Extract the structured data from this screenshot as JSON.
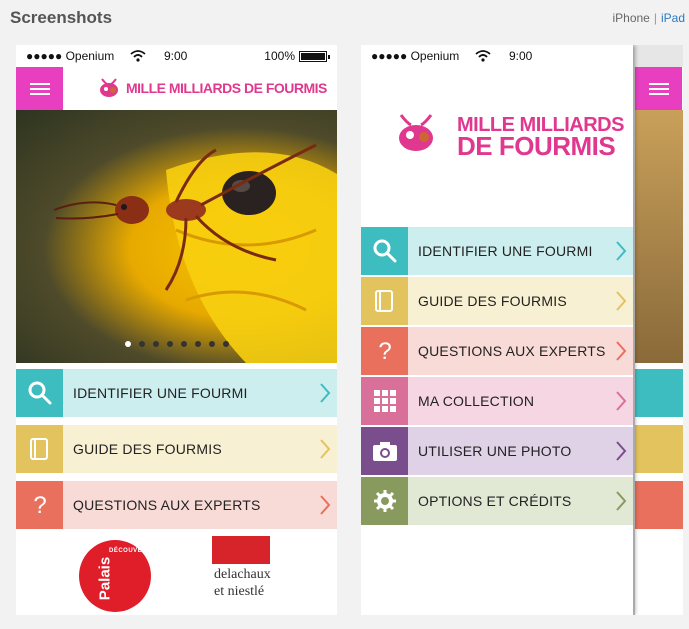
{
  "header": {
    "title": "Screenshots"
  },
  "device_switch": {
    "iphone": "iPhone",
    "separator": "|",
    "ipad": "iPad"
  },
  "status_bar": {
    "carrier": "●●●●● Openium",
    "time": "9:00",
    "battery": "100%"
  },
  "app": {
    "logo_line1": "MILLE MILLIARDS DE FOURMIS",
    "logo_big_line1": "MILLE MILLIARDS",
    "logo_big_line2": "DE FOURMIS",
    "carousel": {
      "count": 8,
      "active": 0
    }
  },
  "home_menu": [
    {
      "label": "IDENTIFIER UNE FOURMI",
      "icon": "search-icon",
      "icon_color": "#3ebdc0",
      "bg": "#cdeeee",
      "chevron_color": "#3ebdc0"
    },
    {
      "label": "GUIDE DES FOURMIS",
      "icon": "book-icon",
      "icon_color": "#e3c35d",
      "bg": "#f8f0d2",
      "chevron_color": "#e3c35d"
    },
    {
      "label": "QUESTIONS AUX EXPERTS",
      "icon": "question-icon",
      "icon_color": "#e8705d",
      "bg": "#f8dbd6",
      "chevron_color": "#e8705d"
    }
  ],
  "drawer_menu": [
    {
      "label": "IDENTIFIER UNE FOURMI",
      "icon": "search-icon",
      "icon_color": "#3ebdc0",
      "bg": "#cdeeee",
      "chevron_color": "#3ebdc0"
    },
    {
      "label": "GUIDE DES FOURMIS",
      "icon": "book-icon",
      "icon_color": "#e3c35d",
      "bg": "#f8f0d2",
      "chevron_color": "#e3c35d"
    },
    {
      "label": "QUESTIONS AUX EXPERTS",
      "icon": "question-icon",
      "icon_color": "#e8705d",
      "bg": "#f8dbd6",
      "chevron_color": "#e8705d"
    },
    {
      "label": "MA COLLECTION",
      "icon": "grid-icon",
      "icon_color": "#d9709a",
      "bg": "#f6d6e2",
      "chevron_color": "#d9709a"
    },
    {
      "label": "UTILISER UNE PHOTO",
      "icon": "camera-icon",
      "icon_color": "#7a4d8c",
      "bg": "#dfd2e6",
      "chevron_color": "#7a4d8c"
    },
    {
      "label": "OPTIONS ET CRÉDITS",
      "icon": "gear-icon",
      "icon_color": "#889a5d",
      "bg": "#e1e8d4",
      "chevron_color": "#889a5d"
    }
  ],
  "partners": {
    "palais": "Palais",
    "palais_sub": "DÉCOUVERTE",
    "delachaux_line1": "delachaux",
    "delachaux_line2": "et niestlé"
  }
}
